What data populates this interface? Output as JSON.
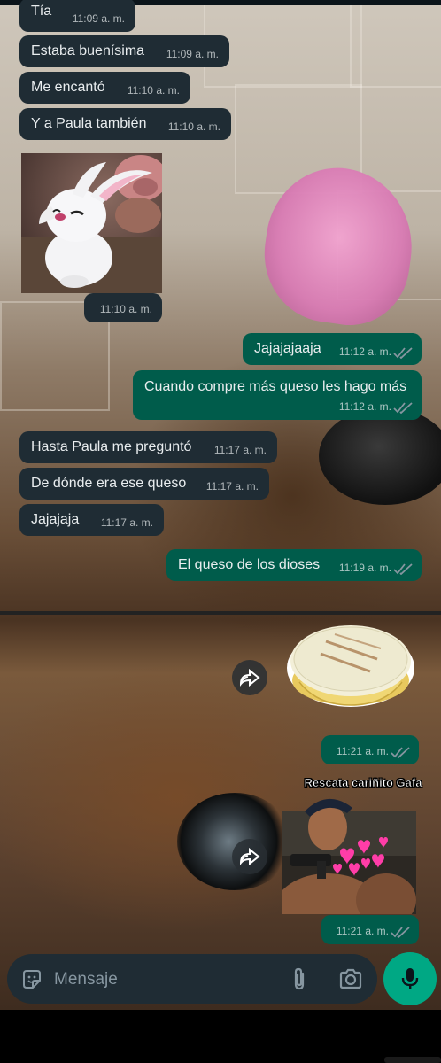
{
  "messages": [
    {
      "dir": "in",
      "text": "Tía",
      "time": "11:09 a. m."
    },
    {
      "dir": "in",
      "text": "Estaba buenísima",
      "time": "11:09 a. m."
    },
    {
      "dir": "in",
      "text": "Me encantó",
      "time": "11:10 a. m."
    },
    {
      "dir": "in",
      "text": "Y a Paula también",
      "time": "11:10 a. m."
    },
    {
      "dir": "in",
      "type": "image",
      "icon": "rabbit-sticker",
      "time": "11:10 a. m."
    },
    {
      "dir": "out",
      "text": "Jajajajaaja",
      "time": "11:12 a. m."
    },
    {
      "dir": "out",
      "text": "Cuando compre más queso les hago más",
      "time": "11:12 a. m."
    },
    {
      "dir": "in",
      "text": "Hasta Paula me preguntó",
      "time": "11:17 a. m."
    },
    {
      "dir": "in",
      "text": "De dónde era ese queso",
      "time": "11:17 a. m."
    },
    {
      "dir": "in",
      "text": "Jajajaja",
      "time": "11:17 a. m."
    },
    {
      "dir": "out",
      "text": "El queso de los dioses",
      "time": "11:19 a. m."
    },
    {
      "dir": "out",
      "type": "sticker",
      "icon": "arepa-sticker",
      "time": "11:21 a. m."
    },
    {
      "dir": "out",
      "type": "sticker",
      "icon": "gun-hearts-sticker",
      "caption": "Rescata cariñito Gafa",
      "time": "11:21 a. m."
    }
  ],
  "composer": {
    "placeholder": "Mensaje",
    "icons": [
      "sticker-icon",
      "attach-icon",
      "camera-icon",
      "mic-icon"
    ]
  },
  "colors": {
    "incoming": "#1f2c34",
    "outgoing": "#005c4b",
    "accent": "#00a884",
    "tick": "#8696a0"
  }
}
